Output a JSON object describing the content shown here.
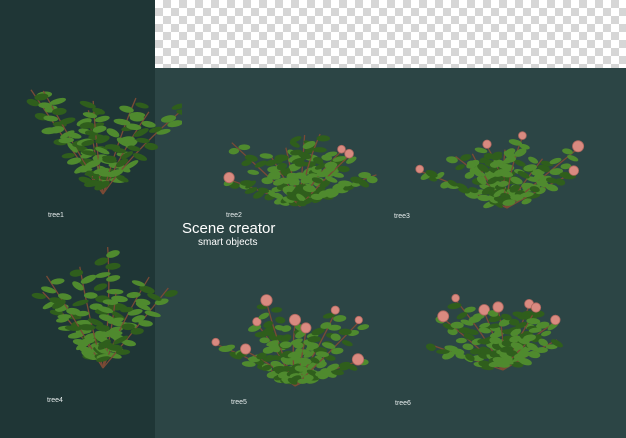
{
  "scene": {
    "title": "Scene creator",
    "subtitle": "smart objects"
  },
  "items": [
    {
      "label": "tree1",
      "flowers": false
    },
    {
      "label": "tree2",
      "flowers": true
    },
    {
      "label": "tree3",
      "flowers": true
    },
    {
      "label": "tree4",
      "flowers": false
    },
    {
      "label": "tree5",
      "flowers": true
    },
    {
      "label": "tree6",
      "flowers": true
    }
  ],
  "colors": {
    "background": "#2c4545",
    "left_panel": "#1f3636",
    "leaf": "#4f8a2e",
    "leaf_dark": "#2f5e1c",
    "flower": "#d98a80"
  }
}
